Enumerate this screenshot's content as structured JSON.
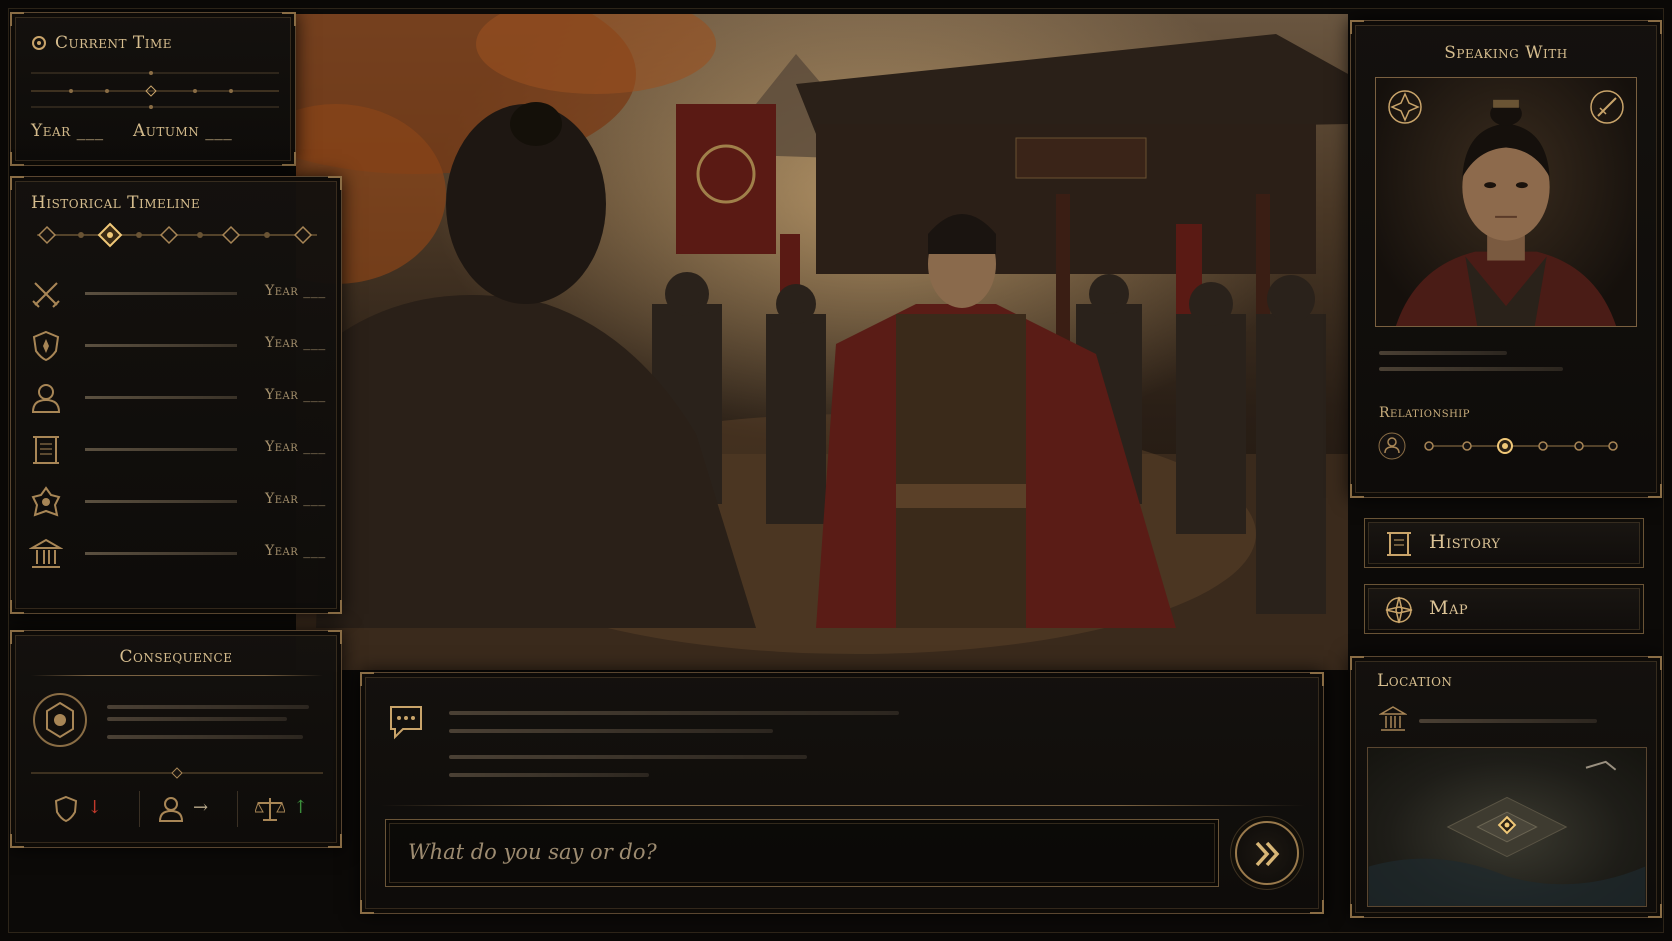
{
  "current_time": {
    "title": "Current Time",
    "year_label": "Year ___",
    "season_label": "Autumn ___"
  },
  "timeline": {
    "title": "Historical Timeline",
    "nodes": 5,
    "active_node": 2,
    "events": [
      {
        "icon": "crossed-swords-icon",
        "year": "Year ___"
      },
      {
        "icon": "shield-icon",
        "year": "Year ___"
      },
      {
        "icon": "person-icon",
        "year": "Year ___"
      },
      {
        "icon": "scroll-icon",
        "year": "Year ___"
      },
      {
        "icon": "emblem-icon",
        "year": "Year ___"
      },
      {
        "icon": "temple-icon",
        "year": "Year ___"
      }
    ]
  },
  "consequence": {
    "title": "Consequence",
    "effects": [
      {
        "icon": "shield-icon",
        "trend": "down",
        "arrow": "↓",
        "color": "#c0392b"
      },
      {
        "icon": "person-icon",
        "trend": "neutral",
        "arrow": "→",
        "color": "#b9a98a"
      },
      {
        "icon": "scales-icon",
        "trend": "up",
        "arrow": "↑",
        "color": "#3c8f3c"
      }
    ]
  },
  "dialogue": {
    "input_placeholder": "What do you say or do?"
  },
  "speaking_with": {
    "title": "Speaking With",
    "relationship_label": "Relationship",
    "relationship_level": 3,
    "relationship_max": 6
  },
  "nav": {
    "history_label": "History",
    "map_label": "Map"
  },
  "location": {
    "title": "Location"
  },
  "colors": {
    "gold": "#c9a46a",
    "panel_border": "#5a4630",
    "text": "#d4bd94"
  }
}
